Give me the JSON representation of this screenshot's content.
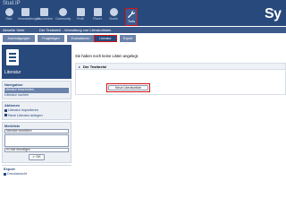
{
  "header": {
    "logo_text": "Stud.IP",
    "brand_text": "Sy",
    "nav": [
      {
        "icon": "home-icon",
        "label": "Start"
      },
      {
        "icon": "courses-icon",
        "label": "Veranstaltungen"
      },
      {
        "icon": "messages-icon",
        "label": "Nachrichten"
      },
      {
        "icon": "community-icon",
        "label": "Community"
      },
      {
        "icon": "profile-icon",
        "label": "Profil"
      },
      {
        "icon": "planner-icon",
        "label": "Planer"
      },
      {
        "icon": "search-icon",
        "label": "Suche"
      },
      {
        "icon": "tools-icon",
        "label": "Tools"
      }
    ]
  },
  "location": {
    "left": "Aktuelle Seite",
    "right": "Der Testkreis! - Verwaltung von Literaturlisten"
  },
  "tabs": [
    {
      "label": "Ankündigungen",
      "active": false
    },
    {
      "label": "Fragebögen",
      "active": false
    },
    {
      "label": "Evaluationen",
      "active": false
    },
    {
      "label": "Literatur",
      "active": true
    },
    {
      "label": "Export",
      "active": false
    }
  ],
  "sidebar": {
    "title": "Literatur",
    "navigation": {
      "title": "Navigation",
      "items": [
        {
          "label": "Literatur bearbeiten",
          "selected": true
        },
        {
          "label": "Literatur suchen",
          "selected": false
        }
      ]
    },
    "actions": {
      "title": "Aktionen",
      "items": [
        "Literatur importieren",
        "Neue Literatur anlegen"
      ]
    },
    "watchlist": {
      "title": "Merkliste",
      "combo_top": "Merkliste bearbeiten",
      "combo_bottom": "In Liste hinzufügen",
      "ok_label": "OK"
    },
    "export": {
      "title": "Export",
      "item": "Druckansicht"
    }
  },
  "main": {
    "empty_message": "Sie haben noch keine Listen angelegt.",
    "panel_title": "Der Testkreis!",
    "new_list_button": "Neue Literaturliste"
  },
  "colors": {
    "header_blue": "#28497c",
    "tab_blue": "#6b83aa",
    "highlight_red": "#d21313"
  }
}
